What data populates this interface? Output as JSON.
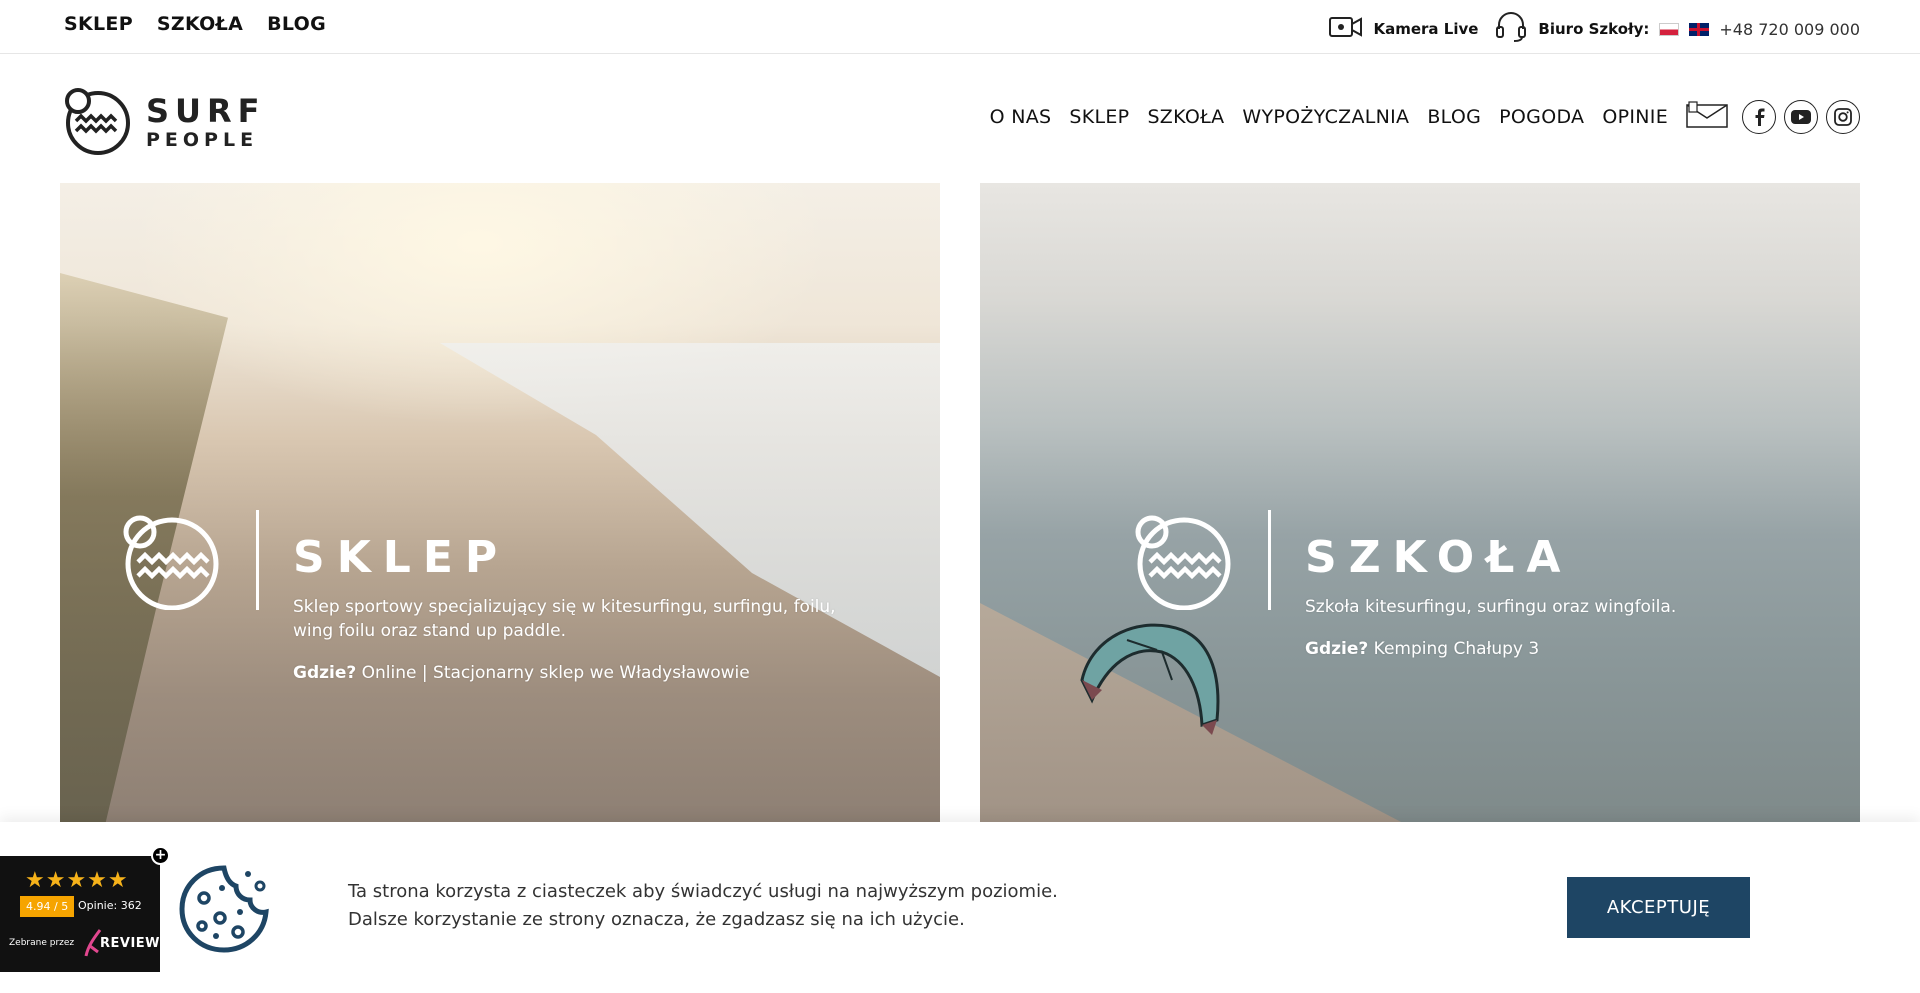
{
  "topbar": {
    "links": [
      "SKLEP",
      "SZKOŁA",
      "BLOG"
    ],
    "camera_label": "Kamera Live",
    "office_label": "Biuro Szkoły:",
    "phone": "+48 720 009 000"
  },
  "logo": {
    "line1": "SURF",
    "line2": "PEOPLE"
  },
  "nav": {
    "items": [
      "O NAS",
      "SKLEP",
      "SZKOŁA",
      "WYPOŻYCZALNIA",
      "BLOG",
      "POGODA",
      "OPINIE"
    ],
    "icons": [
      "mail-icon",
      "facebook-icon",
      "youtube-icon",
      "instagram-icon"
    ]
  },
  "panels": {
    "left": {
      "title": "SKLEP",
      "desc": "Sklep sportowy specjalizujący się w kitesurfingu, surfingu, foilu, wing foilu oraz stand up paddle.",
      "where_label": "Gdzie?",
      "where_value": "Online | Stacjonarny sklep we Władysławowie"
    },
    "right": {
      "title": "SZKOŁA",
      "desc": "Szkoła kitesurfingu, surfingu oraz wingfoila.",
      "where_label": "Gdzie?",
      "where_value": "Kemping Chałupy 3"
    }
  },
  "cookie": {
    "line1": "Ta strona korzysta z ciasteczek aby świadczyć usługi na najwyższym poziomie.",
    "line2": "Dalsze korzystanie ze strony oznacza, że zgadzasz się na ich użycie.",
    "accept": "AKCEPTUJĘ"
  },
  "review": {
    "stars": "★★★★★",
    "score": "4.94 / 5",
    "opinions": "Opinie: 362",
    "collected_by": "Zebrane przez",
    "brand": "REVIEW",
    "close": "+"
  },
  "colors": {
    "accent": "#1e4564",
    "star": "#f6b21a",
    "score_bg": "#f6a400"
  }
}
